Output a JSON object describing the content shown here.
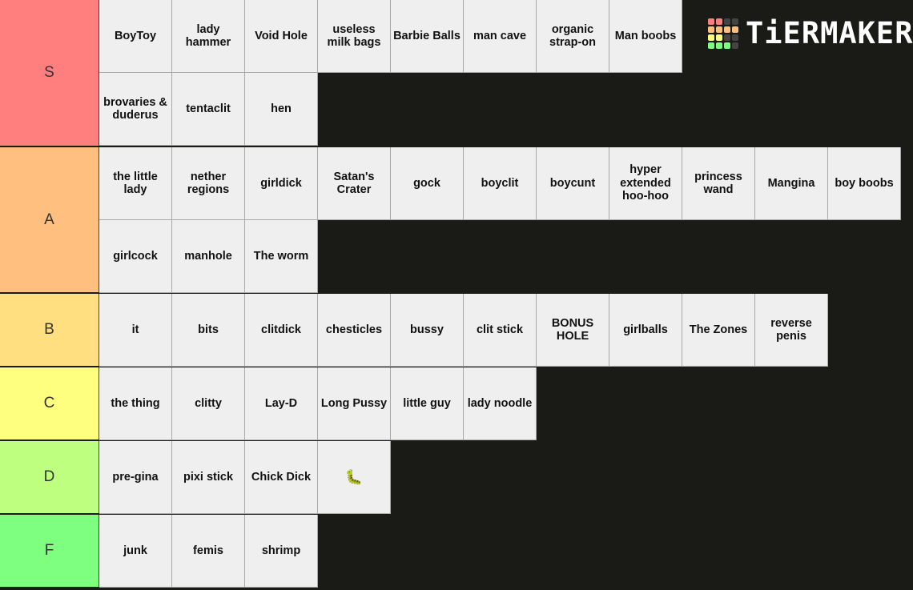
{
  "logo": {
    "text": "TiERMAKER",
    "grid_colors": [
      "#ff7f7f",
      "#ff7f7f",
      "#444444",
      "#444444",
      "#ffbf7f",
      "#ffbf7f",
      "#ffbf7f",
      "#ffbf7f",
      "#ffff7f",
      "#ffff7f",
      "#444444",
      "#444444",
      "#7fff7f",
      "#7fff7f",
      "#7fff7f",
      "#444444"
    ]
  },
  "tiers": [
    {
      "label": "S",
      "color": "#ff7f7f",
      "items": [
        "BoyToy",
        "lady hammer",
        "Void Hole",
        "useless milk bags",
        "Barbie Balls",
        "man cave",
        "organic strap-on",
        "Man boobs",
        "brovaries & duderus",
        "tentaclit",
        "hen"
      ],
      "first_row_count": 8
    },
    {
      "label": "A",
      "color": "#ffbf7f",
      "items": [
        "the little lady",
        "nether regions",
        "girldick",
        "Satan's Crater",
        "gock",
        "boyclit",
        "boycunt",
        "hyper extended hoo-hoo",
        "princess wand",
        "Mangina",
        "boy boobs",
        "girlcock",
        "manhole",
        "The worm"
      ],
      "first_row_count": 11
    },
    {
      "label": "B",
      "color": "#ffdf7f",
      "items": [
        "it",
        "bits",
        "clitdick",
        "chesticles",
        "bussy",
        "clit stick",
        "BONUS HOLE",
        "girlballs",
        "The Zones",
        "reverse penis"
      ],
      "first_row_count": 11
    },
    {
      "label": "C",
      "color": "#ffff7f",
      "items": [
        "the thing",
        "clitty",
        "Lay-D",
        "Long Pussy",
        "little guy",
        "lady noodle"
      ],
      "first_row_count": 11
    },
    {
      "label": "D",
      "color": "#bfff7f",
      "items": [
        "pre-gina",
        "pixi stick",
        "Chick Dick",
        "🐛"
      ],
      "first_row_count": 11
    },
    {
      "label": "F",
      "color": "#7fff7f",
      "items": [
        "junk",
        "femis",
        "shrimp"
      ],
      "first_row_count": 11
    }
  ]
}
